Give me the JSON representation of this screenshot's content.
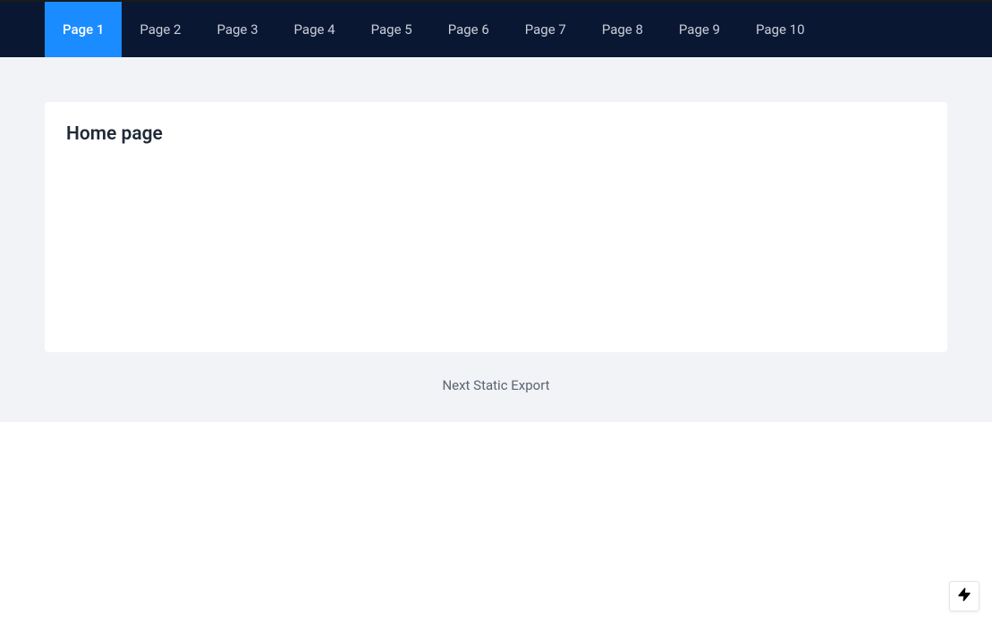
{
  "nav": {
    "items": [
      {
        "label": "Page 1",
        "active": true
      },
      {
        "label": "Page 2",
        "active": false
      },
      {
        "label": "Page 3",
        "active": false
      },
      {
        "label": "Page 4",
        "active": false
      },
      {
        "label": "Page 5",
        "active": false
      },
      {
        "label": "Page 6",
        "active": false
      },
      {
        "label": "Page 7",
        "active": false
      },
      {
        "label": "Page 8",
        "active": false
      },
      {
        "label": "Page 9",
        "active": false
      },
      {
        "label": "Page 10",
        "active": false
      }
    ]
  },
  "main": {
    "title": "Home page"
  },
  "footer": {
    "text": "Next Static Export"
  }
}
